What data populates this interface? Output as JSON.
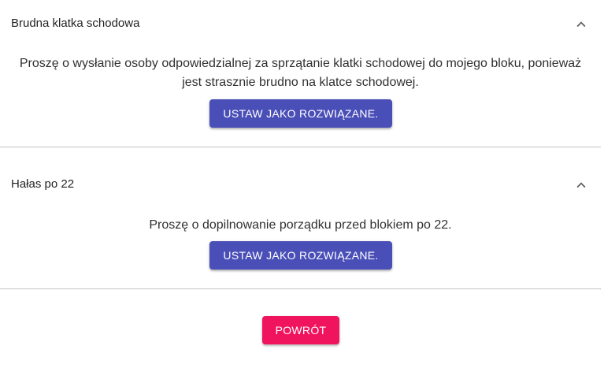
{
  "colors": {
    "primary_button": "#4a4fb8",
    "back_button": "#f0145f",
    "divider": "#c4c4c4"
  },
  "panels": [
    {
      "title": "Brudna klatka schodowa",
      "expand_icon": "chevron-up-icon",
      "text_lines": [
        "Proszę o wysłanie osoby odpowiedzialnej za sprzątanie klatki schodowej do mojego bloku, ponieważ",
        "jest strasznie brudno na klatce schodowej."
      ],
      "button_label": "USTAW JAKO ROZWIĄZANE."
    },
    {
      "title": "Hałas po 22",
      "expand_icon": "chevron-up-icon",
      "text_lines": [
        "Proszę o dopilnowanie porządku przed blokiem po 22."
      ],
      "button_label": "USTAW JAKO ROZWIĄZANE."
    }
  ],
  "back_button_label": "POWRÓT"
}
